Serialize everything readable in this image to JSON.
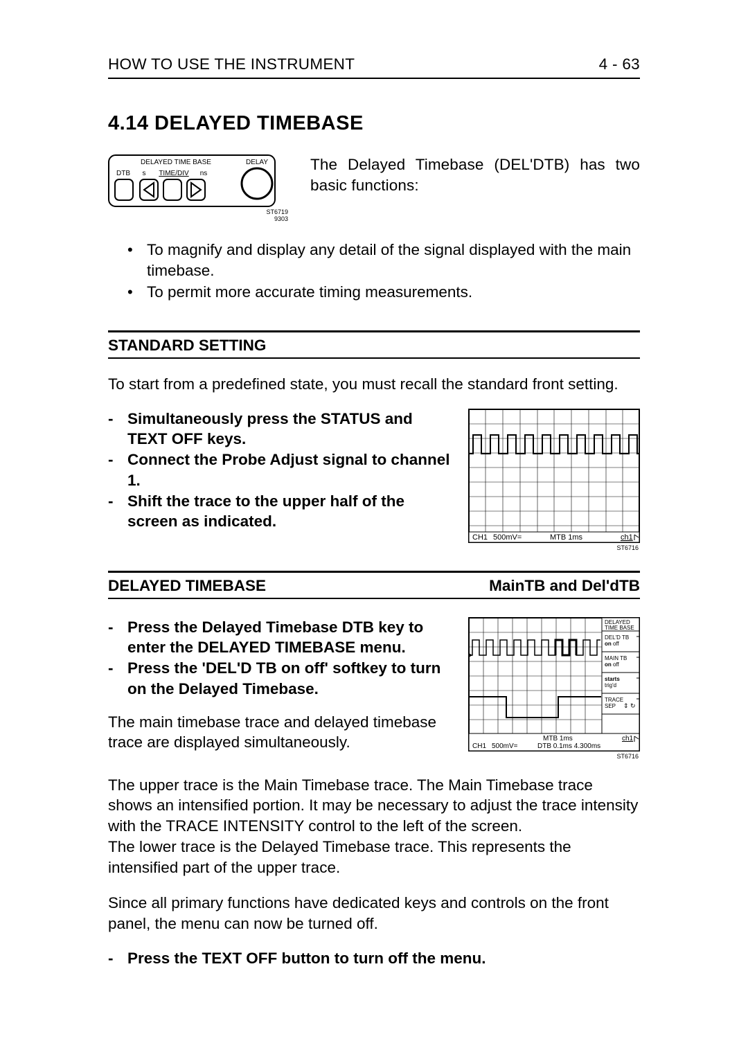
{
  "header": {
    "left": "HOW TO USE THE INSTRUMENT",
    "right": "4 - 63"
  },
  "title": "4.14 DELAYED TIMEBASE",
  "panel": {
    "title": "DELAYED TIME BASE",
    "delay_label": "DELAY",
    "dtb_label": "DTB",
    "s_label": "s",
    "timediv_label": "TIME/DIV",
    "ns_label": "ns",
    "ref1": "ST6719",
    "ref2": "9303"
  },
  "intro": "The Delayed Timebase (DEL'DTB) has two basic functions:",
  "bullets": [
    "To magnify and display any detail of the signal displayed with the main timebase.",
    "To permit more accurate timing measurements."
  ],
  "standard": {
    "heading": "STANDARD SETTING",
    "para": "To start from a predefined state, you must recall the standard front setting.",
    "steps": [
      "Simultaneously press the STATUS and TEXT OFF keys.",
      "Connect the Probe Adjust signal to channel 1.",
      "Shift the trace to the upper half of the screen as indicated."
    ],
    "screen": {
      "ch": "CH1",
      "v": "500mV=",
      "mtb": "MTB 1ms",
      "trig": "ch1",
      "caption": "ST6716"
    }
  },
  "delayed": {
    "heading_left": "DELAYED TIMEBASE",
    "heading_right": "MainTB and Del'dTB",
    "steps": [
      "Press the Delayed Timebase DTB key to enter the DELAYED TIMEBASE menu.",
      "Press the 'DEL'D TB on off' softkey to turn on the Delayed Timebase."
    ],
    "after_steps": "The main timebase trace and delayed timebase trace are displayed simultaneously.",
    "screen": {
      "menu_title1": "DELAYED",
      "menu_title2": "TIME BASE",
      "sk1a": "DEL'D TB",
      "sk1b": "on off",
      "sk2a": "MAIN  TB",
      "sk2b": "on off",
      "sk3a": "starts",
      "sk3b": "trig'd",
      "sk4a": "TRACE",
      "sk4b": "SEP",
      "ch": "CH1",
      "v": "500mV=",
      "mtb": "MTB 1ms",
      "dtb": "DTB 0.1ms 4.300ms",
      "trig": "ch1",
      "caption": "ST6716"
    },
    "para2": "The upper trace is the Main Timebase trace. The Main Timebase trace shows an intensified portion. It may be necessary to adjust the trace intensity with the TRACE INTENSITY control to the left of the screen.",
    "para3": "The lower trace is the Delayed Timebase trace. This represents the intensified part of the upper trace.",
    "para4": "Since all primary functions have dedicated keys and controls on the front panel, the menu can now be turned off.",
    "final_step": "Press the TEXT OFF button to turn off the menu."
  }
}
